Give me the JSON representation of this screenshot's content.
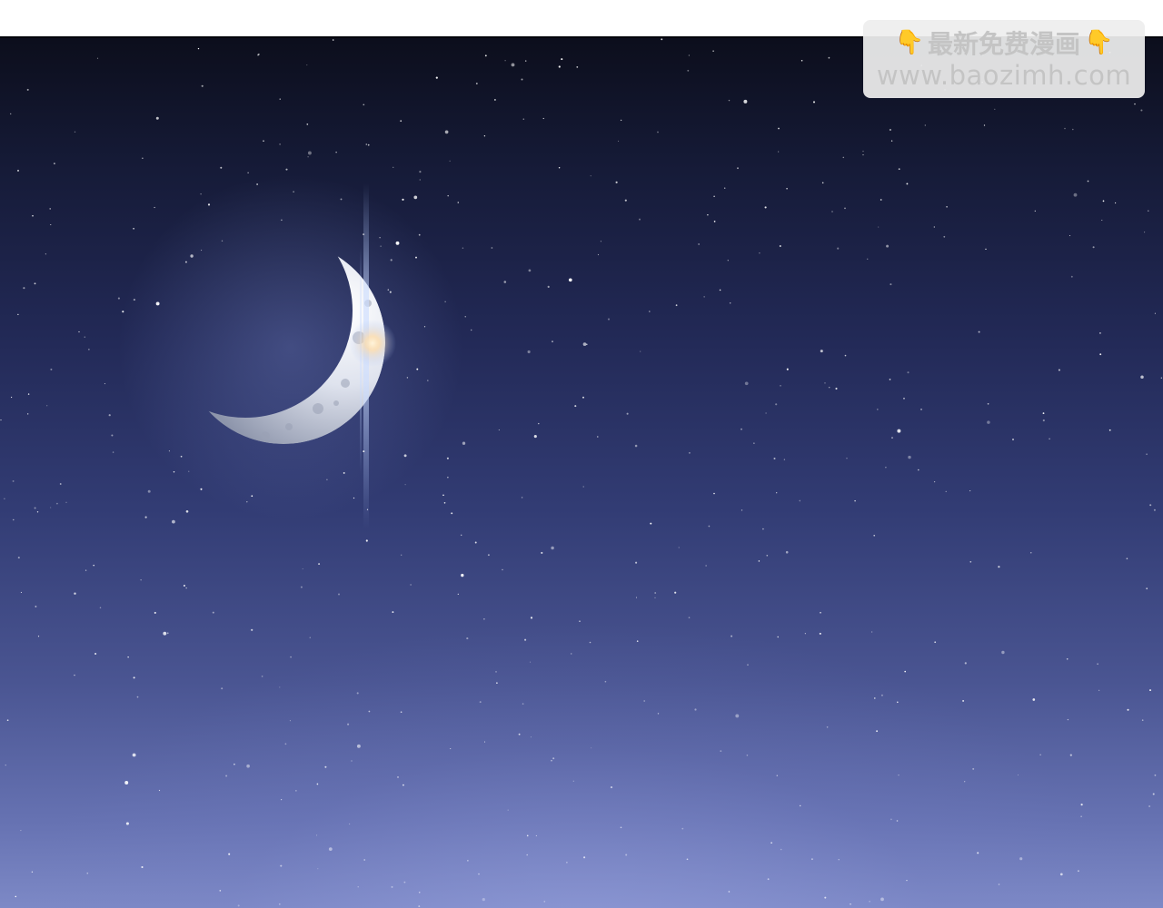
{
  "watermark": {
    "title": "最新免费漫画",
    "url": "www.baozimh.com",
    "pointer_icon_left": "pointing-down-hand-icon",
    "pointer_icon_right": "pointing-down-hand-icon",
    "pointer_glyph": "👇"
  },
  "scene": {
    "subject": "crescent-moon-icon",
    "sky_top_color": "#0c0e1c",
    "sky_bottom_color": "#7d89c6",
    "moon_color": "#dfe3ee",
    "glow_color": "#a9c4ff"
  }
}
